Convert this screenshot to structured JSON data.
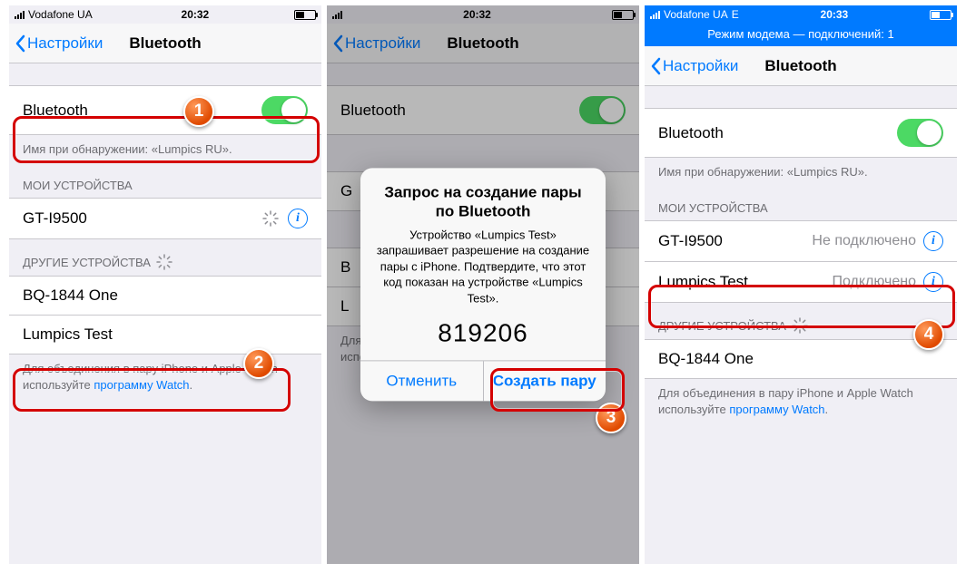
{
  "badges": {
    "b1": "1",
    "b2": "2",
    "b3": "3",
    "b4": "4"
  },
  "p1": {
    "status": {
      "carrier": "Vodafone UA",
      "time": "20:32"
    },
    "nav": {
      "back": "Настройки",
      "title": "Bluetooth"
    },
    "bt_row": {
      "label": "Bluetooth"
    },
    "discover_note": "Имя при обнаружении: «Lumpics RU».",
    "my_header": "МОИ УСТРОЙСТВА",
    "my_dev1": "GT-I9500",
    "other_header": "ДРУГИЕ УСТРОЙСТВА",
    "other_dev1": "BQ-1844 One",
    "other_dev2": "Lumpics Test",
    "footer_a": "Для объединения в пару iPhone и Apple Watch используйте ",
    "footer_link": "программу Watch",
    "footer_dot": "."
  },
  "p2": {
    "status": {
      "time": "20:32"
    },
    "nav": {
      "back": "Настройки",
      "title": "Bluetooth"
    },
    "bt_row": {
      "label": "Bluetooth"
    },
    "alert": {
      "title": "Запрос на создание пары по Bluetooth",
      "msg": "Устройство «Lumpics Test» запрашивает разрешение на создание пары с iPhone. Подтвердите, что этот код показан на устройстве «Lumpics Test».",
      "code": "819206",
      "cancel": "Отменить",
      "pair": "Создать пару"
    }
  },
  "p3": {
    "status": {
      "carrier": "Vodafone UA",
      "net": "E",
      "time": "20:33"
    },
    "hotspot": "Режим модема — подключений: 1",
    "nav": {
      "back": "Настройки",
      "title": "Bluetooth"
    },
    "bt_row": {
      "label": "Bluetooth"
    },
    "discover_note": "Имя при обнаружении: «Lumpics RU».",
    "my_header": "МОИ УСТРОЙСТВА",
    "my_dev1": {
      "name": "GT-I9500",
      "status": "Не подключено"
    },
    "my_dev2": {
      "name": "Lumpics Test",
      "status": "Подключено"
    },
    "other_header": "ДРУГИЕ УСТРОЙСТВА",
    "other_dev1": "BQ-1844 One",
    "footer_a": "Для объединения в пару iPhone и Apple Watch используйте ",
    "footer_link": "программу Watch",
    "footer_dot": "."
  }
}
